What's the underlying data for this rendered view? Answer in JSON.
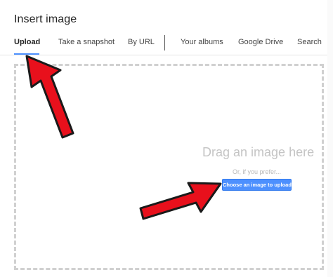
{
  "dialog": {
    "title": "Insert image"
  },
  "tabs": [
    {
      "label": "Upload",
      "active": true
    },
    {
      "label": "Take a snapshot",
      "active": false
    },
    {
      "label": "By URL",
      "active": false
    },
    {
      "label": "Your albums",
      "active": false
    },
    {
      "label": "Google Drive",
      "active": false
    },
    {
      "label": "Search",
      "active": false
    }
  ],
  "dropzone": {
    "heading": "Drag an image here",
    "or_text": "Or, if you prefer...",
    "button_label": "Choose an image to upload"
  },
  "colors": {
    "accent": "#4d90fe",
    "arrow_fill": "#e8101c",
    "arrow_outline": "#1a1a1a"
  }
}
